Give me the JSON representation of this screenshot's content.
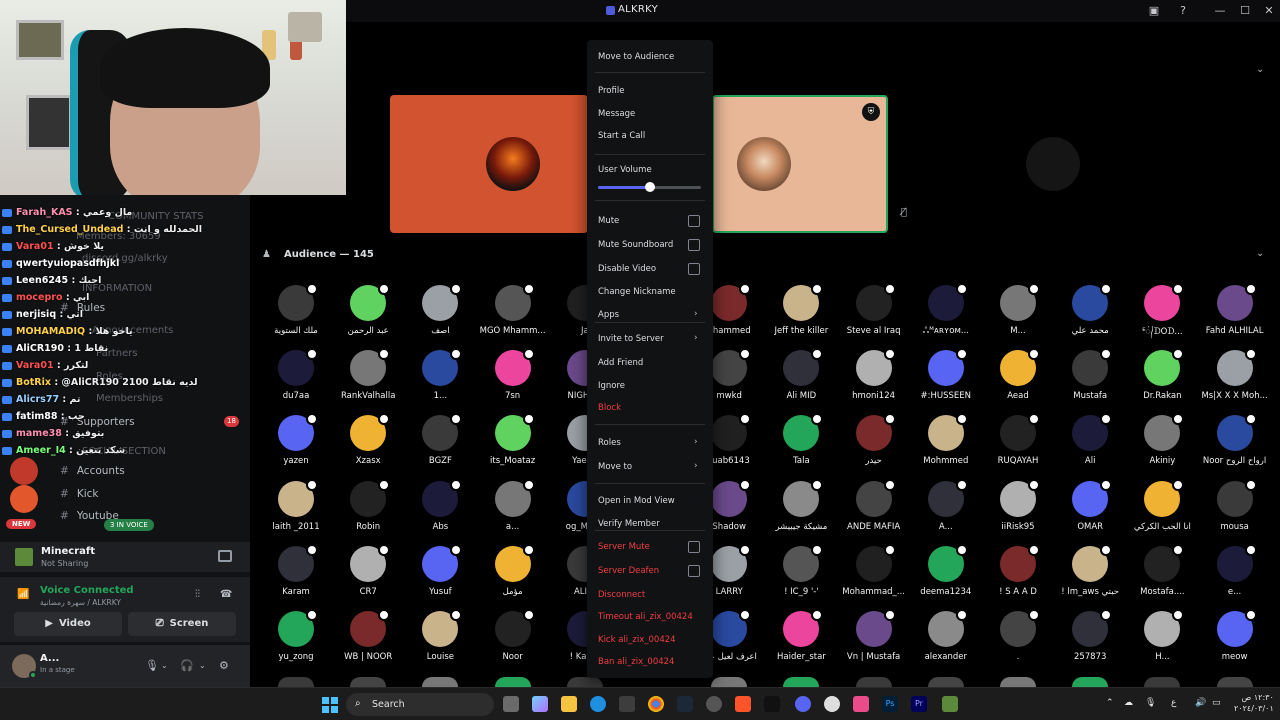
{
  "app": {
    "title": "ALKRKY"
  },
  "stage": {
    "audience_header": "Audience — 145"
  },
  "left": {
    "chat": [
      {
        "name": "Farah_KAS",
        "msg": ": مال وعمي",
        "color": "#ff8fb0"
      },
      {
        "name": "The_Cursed_Undead",
        "msg": ": الحمدلله و انت",
        "color": "#ffd24a"
      },
      {
        "name": "Vara01",
        "msg": ": يلا خوش",
        "color": "#ff5050"
      },
      {
        "name": "qwertyuiopasdfhjkl",
        "msg": "",
        "color": "#ffffff"
      },
      {
        "name": "Leen6245",
        "msg": ": احبك",
        "color": "#ffffff"
      },
      {
        "name": "mocepro",
        "msg": ": ابي",
        "color": "#ff5050"
      },
      {
        "name": "nerjisiq",
        "msg": ": اتي",
        "color": "#ffffff"
      },
      {
        "name": "MOHAMADIQ",
        "msg": ": ياخو هلا",
        "color": "#ffd24a"
      },
      {
        "name": "AliCR190",
        "msg": ": نقاط 1",
        "color": "#ffffff"
      },
      {
        "name": "Vara01",
        "msg": ": لتكرر",
        "color": "#ff5050"
      },
      {
        "name": "BotRix",
        "msg": ": @AliCR190 2100 لديه نقاط",
        "color": "#ffd24a"
      },
      {
        "name": "Alicrs77",
        "msg": ": تم",
        "color": "#9ad0ff"
      },
      {
        "name": "fatim88",
        "msg": ": حب",
        "color": "#ffffff"
      },
      {
        "name": "mame38",
        "msg": ": بتوفيق",
        "color": "#ff8fb0"
      },
      {
        "name": "Ameer_I4",
        "msg": ": شكد تتعين",
        "color": "#7bff7b"
      }
    ],
    "ghost": {
      "community_stats": "COMMUNITY STATS",
      "members": "Members: 30659",
      "discord_link": "discord.gg/alkrky",
      "information": "INFORMATION",
      "announcements": "Announcements",
      "partners": "Partners",
      "roles": "Roles",
      "memberships": "Memberships",
      "social_section": "SOCIAL SECTION"
    },
    "channels": {
      "rules": "Rules",
      "supporters": "Supporters",
      "supporters_badge": "18",
      "accounts": "Accounts",
      "kick": "Kick",
      "youtube": "Youtube"
    },
    "in_voice": "3 IN VOICE",
    "new_pill": "NEW",
    "activity": {
      "title": "Minecraft",
      "subtitle": "Not Sharing"
    },
    "voice": {
      "status": "Voice Connected",
      "detail": "سهرة رمضانية / ALKRKY",
      "video_label": "Video",
      "screen_label": "Screen"
    },
    "user": {
      "name": "A...",
      "status": "In a stage"
    }
  },
  "members": [
    [
      "ملك الستوية",
      "عبد الرحمن",
      "آصف",
      "MGO Mhamm...",
      "Ja",
      "",
      "ohammed",
      "Jeff the killer",
      "Steve al Iraq",
      "ஃᴹᴀʀʏᴏᴍ...",
      "M...",
      "محمد علي",
      "ᴱ᭄ᗪOᗪ...",
      "Fahd ALHILAL"
    ],
    [
      "du7aa",
      "RankValhalla",
      "1...",
      "7sn",
      "NIGHT F",
      "",
      "mwkd",
      "Ali MID",
      "hmoni124",
      "#:HUSSEEN",
      "Aead",
      "Mustafa",
      "Dr.Rakan",
      "Ms|X X X Moh..."
    ],
    [
      "yazen",
      "Xzasx",
      "BGZF",
      "its_Moataz",
      "Yaequ",
      "",
      "ruab6143",
      "Tala",
      "حيدر",
      "Mohmmed",
      "RUQAYAH",
      "Ali",
      "Akiniy",
      "Noor ارواح الروح"
    ],
    [
      "laith _2011",
      "Robin",
      "Abs",
      "a...",
      "og_Moha",
      "",
      "Shadow",
      "مشيكة جيبيشر",
      "ANDE MAFIA",
      "A...",
      "iiRisk95",
      "OMAR",
      "انا الحب الكركي",
      "mousa"
    ],
    [
      "Karam",
      "CR7",
      "Yusuf",
      "مؤمل",
      "ALI C",
      "",
      "LARRY",
      "! IC_9 '-'",
      "Mohammad_...",
      "deema1234",
      "! S A A D",
      "! lm_aws حبتي",
      "Mostafa....",
      "e..."
    ],
    [
      "yu_zong",
      "WB | NOOR",
      "Louise",
      "Noor",
      "! Kakar",
      "",
      "اعرف لعيل عب",
      "Haider_star",
      "Vn | Mustafa",
      "alexander",
      ".",
      "257873",
      "H...",
      "meow"
    ]
  ],
  "menu": {
    "items": [
      {
        "label": "Move to Audience",
        "red": false,
        "arrow": false,
        "check": false
      },
      {
        "label": "Profile",
        "red": false,
        "arrow": false,
        "check": false
      },
      {
        "label": "Message",
        "red": false,
        "arrow": false,
        "check": false
      },
      {
        "label": "Start a Call",
        "red": false,
        "arrow": false,
        "check": false
      },
      {
        "label": "User Volume",
        "red": false,
        "arrow": false,
        "check": false
      },
      {
        "label": "Mute",
        "red": false,
        "arrow": false,
        "check": true
      },
      {
        "label": "Mute Soundboard",
        "red": false,
        "arrow": false,
        "check": true
      },
      {
        "label": "Disable Video",
        "red": false,
        "arrow": false,
        "check": true
      },
      {
        "label": "Change Nickname",
        "red": false,
        "arrow": false,
        "check": false
      },
      {
        "label": "Apps",
        "red": false,
        "arrow": true,
        "check": false
      },
      {
        "label": "Invite to Server",
        "red": false,
        "arrow": true,
        "check": false
      },
      {
        "label": "Add Friend",
        "red": false,
        "arrow": false,
        "check": false
      },
      {
        "label": "Ignore",
        "red": false,
        "arrow": false,
        "check": false
      },
      {
        "label": "Block",
        "red": true,
        "arrow": false,
        "check": false
      },
      {
        "label": "Roles",
        "red": false,
        "arrow": true,
        "check": false
      },
      {
        "label": "Move to",
        "red": false,
        "arrow": true,
        "check": false
      },
      {
        "label": "Open in Mod View",
        "red": false,
        "arrow": false,
        "check": false
      },
      {
        "label": "Verify Member",
        "red": false,
        "arrow": false,
        "check": false
      },
      {
        "label": "Server Mute",
        "red": true,
        "arrow": false,
        "check": true
      },
      {
        "label": "Server Deafen",
        "red": true,
        "arrow": false,
        "check": true
      },
      {
        "label": "Disconnect",
        "red": true,
        "arrow": false,
        "check": false
      },
      {
        "label": "Timeout ali_zix_00424",
        "red": true,
        "arrow": false,
        "check": false
      },
      {
        "label": "Kick ali_zix_00424",
        "red": true,
        "arrow": false,
        "check": false
      },
      {
        "label": "Ban ali_zix_00424",
        "red": true,
        "arrow": false,
        "check": false
      }
    ],
    "volume_fraction": 0.5
  },
  "taskbar": {
    "search_placeholder": "Search",
    "clock_time": "١٢:٣٠ ص",
    "clock_date": "٢٠٢٤/٠٣/٠١",
    "lang": "ع"
  },
  "colors": {
    "accent": "#5865f2",
    "danger": "#f23f43",
    "online": "#23a55a"
  }
}
